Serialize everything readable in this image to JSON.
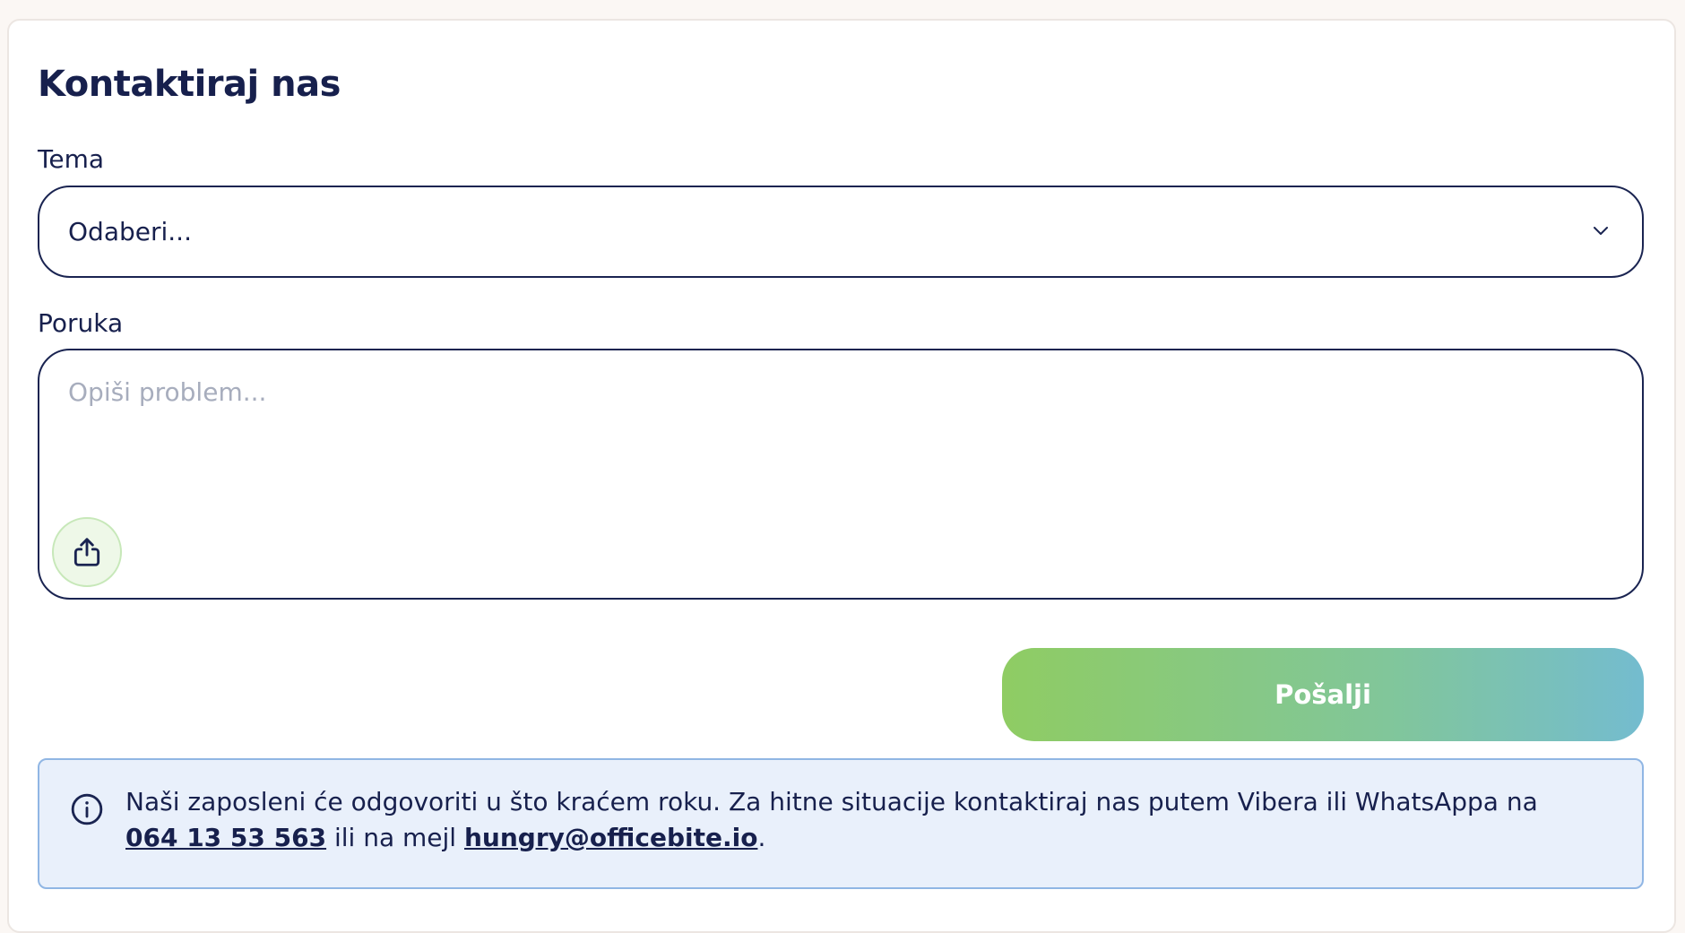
{
  "form": {
    "title": "Kontaktiraj nas",
    "topic_label": "Tema",
    "topic_selected": "Odaberi...",
    "message_label": "Poruka",
    "message_placeholder": "Opiši problem...",
    "message_value": "",
    "send_label": "Pošalji"
  },
  "info": {
    "text_before_phone": "Naši zaposleni će odgovoriti u što kraćem roku. Za hitne situacije kontaktiraj nas putem Vibera ili WhatsAppa na ",
    "phone": "064 13 53 563",
    "text_between": " ili na mejl ",
    "email": "hungry@officebite.io",
    "text_after": "."
  },
  "icons": {
    "select_chevron": "chevron-down-icon",
    "upload": "upload-icon",
    "info": "info-icon"
  },
  "colors": {
    "primary_text": "#17204d",
    "send_gradient_start": "#8fcc63",
    "send_gradient_end": "#74bccf",
    "info_background": "#e9f0fb",
    "info_border": "#90b6e4"
  }
}
